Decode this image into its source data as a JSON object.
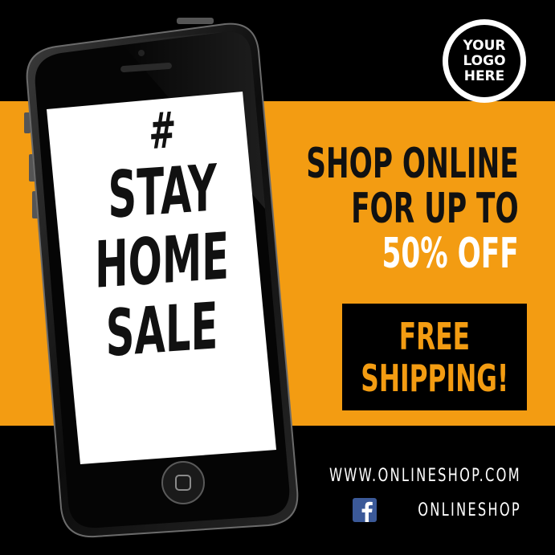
{
  "logo": {
    "line1": "YOUR",
    "line2": "LOGO",
    "line3": "HERE"
  },
  "phone_screen": {
    "hash": "#",
    "line1": "STAY",
    "line2": "HOME",
    "line3": "SALE"
  },
  "offer": {
    "line1": "SHOP ONLINE",
    "line2": "FOR UP TO",
    "line3": "50% OFF"
  },
  "shipping": {
    "line1": "FREE",
    "line2": "SHIPPING!"
  },
  "footer": {
    "website": "WWW.ONLINESHOP.COM",
    "social_handle": "ONLINESHOP",
    "social_icon": "facebook-icon"
  },
  "colors": {
    "background": "#000000",
    "band": "#f39c12",
    "accent_text": "#f39c12",
    "facebook": "#3b5998",
    "white": "#ffffff"
  }
}
